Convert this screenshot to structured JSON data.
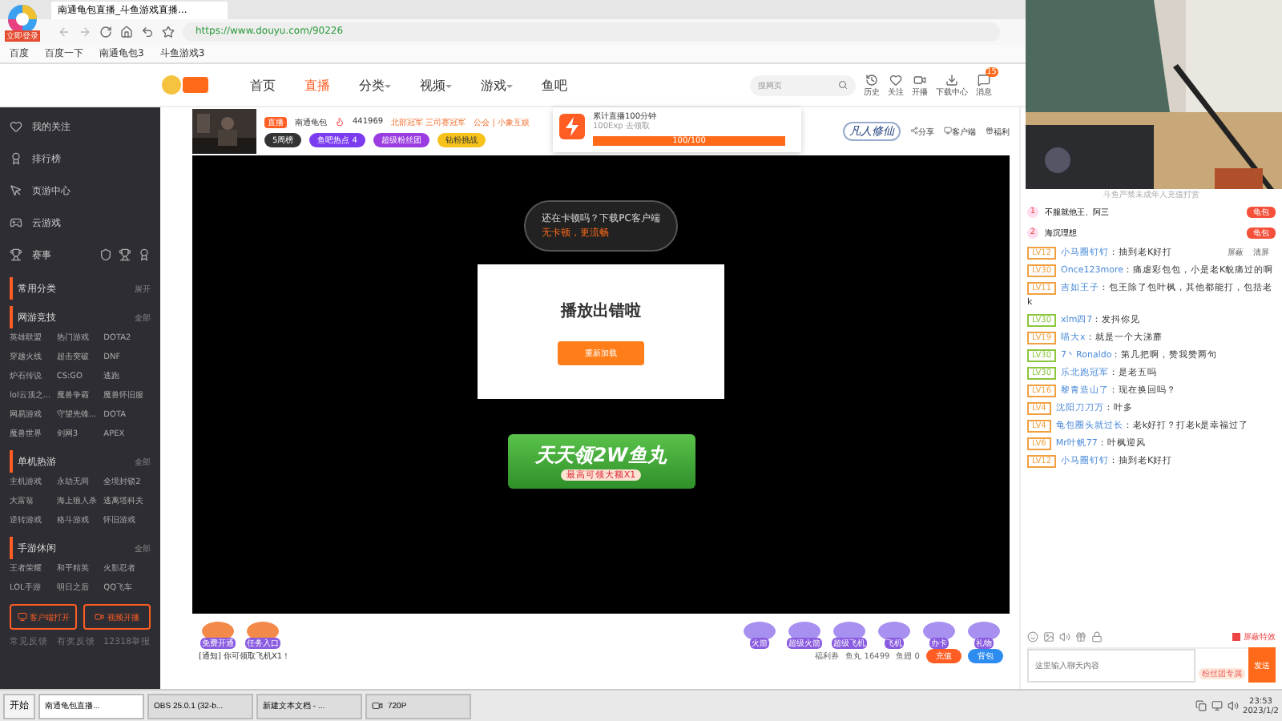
{
  "browser": {
    "login_badge": "立即登录",
    "tabs": [
      {
        "label": "南通龟包直播_斗鱼游戏直播...",
        "selected": true
      }
    ],
    "url": "https://www.douyu.com/90226",
    "bookmarks": [
      "百度",
      "百度一下",
      "南通龟包3",
      "斗鱼游戏3"
    ]
  },
  "header": {
    "nav": [
      {
        "label": "首页",
        "selected": false,
        "dropdown": false
      },
      {
        "label": "直播",
        "selected": true,
        "dropdown": false
      },
      {
        "label": "分类",
        "selected": false,
        "dropdown": true
      },
      {
        "label": "视频",
        "selected": false,
        "dropdown": true
      },
      {
        "label": "游戏",
        "selected": false,
        "dropdown": true
      },
      {
        "label": "鱼吧",
        "selected": false,
        "dropdown": false
      }
    ],
    "search": {
      "placeholder": "搜网页"
    },
    "actions": [
      {
        "kind": "history",
        "label": "历史"
      },
      {
        "kind": "follow",
        "label": "关注"
      },
      {
        "kind": "live",
        "label": "开播"
      },
      {
        "kind": "download",
        "label": "下载中心"
      },
      {
        "kind": "message",
        "label": "消息",
        "badge": "15"
      }
    ]
  },
  "sidebar": {
    "items": [
      {
        "kind": "heart",
        "label": "我的关注"
      },
      {
        "kind": "rank",
        "label": "排行榜"
      },
      {
        "kind": "mouse",
        "label": "页游中心"
      },
      {
        "kind": "game",
        "label": "云游戏"
      },
      {
        "kind": "trophy",
        "label": "赛事"
      }
    ],
    "common": {
      "title": "常用分类",
      "action": "展开"
    },
    "groups": [
      {
        "title": "网游竞技",
        "action": "全部",
        "games": [
          "英雄联盟",
          "热门游戏",
          "DOTA2",
          "穿越火线",
          "超击突破",
          "DNF",
          "炉石传说",
          "CS:GO",
          "逃跑",
          "lol云顶之...",
          "魔兽争霸",
          "魔兽怀旧服",
          "网易游戏",
          "守望先锋...",
          "DOTA",
          "魔兽世界",
          "剑网3",
          "APEX"
        ]
      },
      {
        "title": "单机热游",
        "action": "全部",
        "games": [
          "主机游戏",
          "永劫无间",
          "全境封锁2",
          "大富翁",
          "海上狼人杀",
          "逃离塔科夫",
          "逆转游戏",
          "格斗游戏",
          "怀旧游戏"
        ]
      },
      {
        "title": "手游休闲",
        "action": "全部",
        "games": [
          "王者荣耀",
          "和平精英",
          "火影忍者",
          "LOL手游",
          "明日之后",
          "QQ飞车"
        ]
      }
    ],
    "buttons": [
      {
        "kind": "client",
        "label": "客户端打开"
      },
      {
        "kind": "video",
        "label": "视频开播"
      }
    ],
    "footer": [
      "常见反馈",
      "有奖反馈",
      "12318举报"
    ]
  },
  "room": {
    "tag": "直播",
    "name": "南通龟包",
    "hot": "441969",
    "honor": "北部冠军 三司赛冠军",
    "guild": "公会 | 小象互娱",
    "pills": [
      {
        "label": "5周榜",
        "color": "#333333"
      },
      {
        "label": "鱼吧热点 4",
        "color": "#7b3cf0"
      },
      {
        "label": "超级粉丝团",
        "color": "#9a3ce0"
      },
      {
        "label": "钻粉挑战",
        "color": "#f7c31a"
      }
    ],
    "task": {
      "title": "累计直播100分钟",
      "subtitle": "100Exp 去领取",
      "progress": "100/100",
      "level": 1
    },
    "ad": "凡人修仙",
    "links": [
      {
        "kind": "share",
        "label": "分享"
      },
      {
        "kind": "client",
        "label": "客户端"
      },
      {
        "kind": "gift",
        "label": "福利"
      }
    ]
  },
  "player": {
    "bubble": {
      "line1": "还在卡顿吗？下载PC客户端",
      "line2": "无卡顿，更流畅"
    },
    "error": {
      "title": "播放出错啦",
      "button": "重新加载"
    },
    "banner": {
      "title": "天天领2W鱼丸",
      "subtitle": "最高可领大额X1"
    }
  },
  "giftbar": {
    "left": [
      "免费开通",
      "任务入口"
    ],
    "right": [
      "火箭",
      "超级火箭",
      "超级飞机",
      "飞机",
      "办卡",
      "礼物"
    ],
    "notice": "[通知] 你可领取飞机X1！",
    "coupon": "福利券",
    "yuwan": "鱼丸 16499",
    "yuchi": "鱼翅 0",
    "recharge": "充值",
    "bag": "背包"
  },
  "chat": {
    "notice": "斗鱼严禁未成年人充值打赏",
    "ranks": [
      {
        "rank": "1",
        "name": "不服就他王、阿三",
        "badge": "龟包"
      },
      {
        "rank": "2",
        "name": "海沉理想",
        "badge": "龟包"
      }
    ],
    "filters": [
      "屏蔽",
      "清屏"
    ],
    "messages": [
      {
        "level": "LV12",
        "color": "#f0a040",
        "user": "小马圈钉钉",
        "text": "：抽到老K好打"
      },
      {
        "level": "LV30",
        "color": "#f0a040",
        "user": "Once123more",
        "text": "：痛虐彩包包，小是老K貌痛过的啊"
      },
      {
        "level": "LV11",
        "color": "#f0a040",
        "user": "吉如王子",
        "text": "：包王除了包叶枫，其他都能打，包括老k"
      },
      {
        "level": "LV30",
        "color": "#8cc63e",
        "user": "xlm四7",
        "text": "：发抖你见"
      },
      {
        "level": "LV19",
        "color": "#f0a040",
        "user": "喵大x",
        "text": "：就是一个大涕蘼"
      },
      {
        "level": "LV30",
        "color": "#8cc63e",
        "user": "7丶Ronaldo",
        "text": "：第几把啊，赞我赞两句"
      },
      {
        "level": "LV30",
        "color": "#8cc63e",
        "user": "乐北跑冠军",
        "text": "：是老五吗"
      },
      {
        "level": "LV16",
        "color": "#f0a040",
        "user": "黎青造山了",
        "text": "：现在换回吗？"
      },
      {
        "level": "LV4",
        "color": "#f0a040",
        "user": "沈阳刀刀万",
        "text": "：叶多"
      },
      {
        "level": "LV4",
        "color": "#f0a040",
        "user": "龟包圈头就过长",
        "text": "：老k好打？打老k是幸福过了"
      },
      {
        "level": "LV6",
        "color": "#f0a040",
        "user": "Mr叶帆77",
        "text": "：叶枫迎风"
      },
      {
        "level": "LV12",
        "color": "#f0a040",
        "user": "小马圈钉钉",
        "text": "：抽到老K好打"
      }
    ],
    "mute_effects": {
      "label": "屏蔽特效",
      "checked": true
    },
    "input": {
      "placeholder": "这里输入聊天内容"
    },
    "fan_tag": "粉丝团专属",
    "send": "发送"
  },
  "taskbar": {
    "start": "开始",
    "tasks": [
      {
        "kind": "browser",
        "label": "南通龟包直播...",
        "selected": true
      },
      {
        "kind": "obs",
        "label": "OBS 25.0.1 (32-b...",
        "selected": false
      },
      {
        "kind": "doc",
        "label": "新建文本文档 - ...",
        "selected": false
      },
      {
        "kind": "video",
        "label": "720P",
        "selected": false
      }
    ],
    "time": "23:53",
    "date": "2023/1/2"
  }
}
